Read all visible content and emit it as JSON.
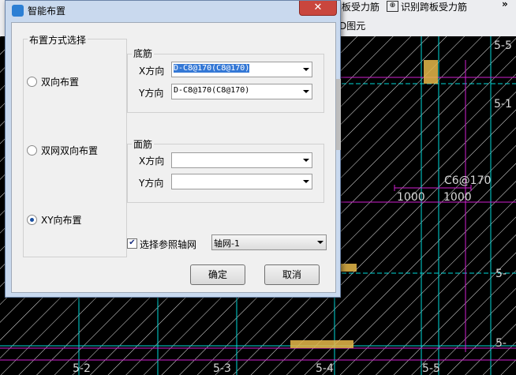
{
  "toolbar": {
    "item_board_rebar": "板受力筋",
    "item_recognize_span": "识别跨板受力筋",
    "item_graphic": "D图元",
    "more": "»"
  },
  "canvas": {
    "labels": [
      "5-5",
      "5-1",
      "5-",
      "5-",
      "5-2",
      "5-3",
      "5-4",
      "5-5"
    ],
    "rebar_label": "C6@170",
    "dim_left": "1000",
    "dim_right": "1000"
  },
  "dialog": {
    "title": "智能布置",
    "close_glyph": "✕",
    "layout_group": {
      "title": "布置方式选择",
      "options": [
        {
          "label": "双向布置",
          "selected": false
        },
        {
          "label": "双网双向布置",
          "selected": false
        },
        {
          "label": "XY向布置",
          "selected": true
        }
      ]
    },
    "bottom_rebar": {
      "title": "底筋",
      "x_label": "X方向",
      "x_value": "D-C8@170(C8@170)",
      "y_label": "Y方向",
      "y_value": "D-C8@170(C8@170)"
    },
    "top_rebar": {
      "title": "面筋",
      "x_label": "X方向",
      "x_value": "",
      "y_label": "Y方向",
      "y_value": ""
    },
    "axis_ref": {
      "checkbox_label": "选择参照轴网",
      "checked": true,
      "axis_value": "轴网-1"
    },
    "ok_label": "确定",
    "cancel_label": "取消"
  },
  "colors": {
    "accent": "#3478d6",
    "close_red": "#c9463d",
    "cad_cyan": "#00d8d8",
    "cad_magenta": "#d01fd0",
    "cad_yellow": "#e6b84a"
  }
}
